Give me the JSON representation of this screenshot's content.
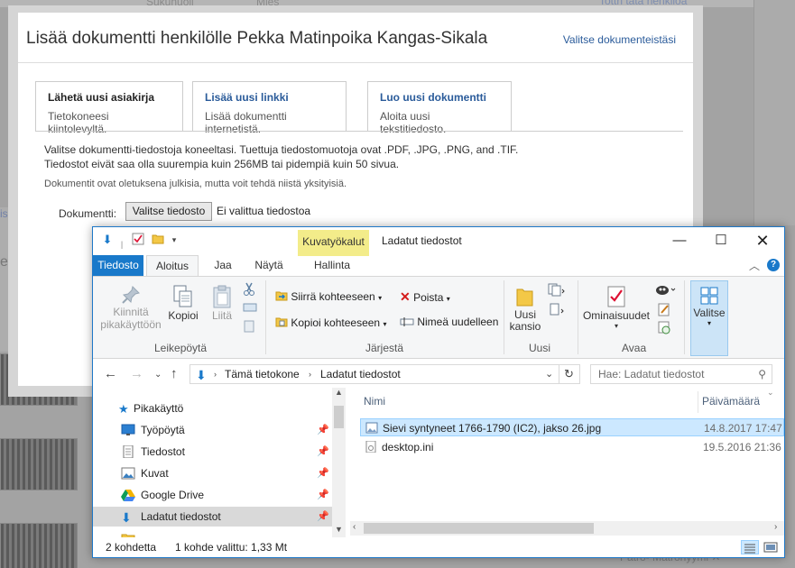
{
  "background": {
    "top_labels": [
      "Sukunuoli",
      "Mies",
      "Tottri tata henkilöä"
    ],
    "left_link": "is",
    "left_letter": "e",
    "bottom_text": "Patro- Matronyymi ✕"
  },
  "dialog": {
    "title": "Lisää dokumentti henkilölle Pekka Matinpoika Kangas-Sikala",
    "choose_link": "Valitse dokumenteistäsi",
    "tabs": [
      {
        "title": "Lähetä uusi asiakirja",
        "subtitle": "Tietokoneesi kiintolevyltä."
      },
      {
        "title": "Lisää uusi linkki",
        "subtitle": "Lisää dokumentti internetistä."
      },
      {
        "title": "Luo uusi dokumentti",
        "subtitle": "Aloita uusi tekstitiedosto."
      }
    ],
    "info_line1": "Valitse dokumentti-tiedostoja koneeltasi. Tuettuja tiedostomuotoja ovat .PDF, .JPG, .PNG, and .TIF.",
    "info_line2": "Tiedostot eivät saa olla suurempia kuin 256MB tai pidempiä kuin 50 sivua.",
    "note": "Dokumentit ovat oletuksena julkisia, mutta voit tehdä niistä yksityisiä.",
    "document_label": "Dokumentti:",
    "file_button": "Valitse tiedosto",
    "file_status": "Ei valittua tiedostoa"
  },
  "explorer": {
    "context_tab": "Kuvatyökalut",
    "title": "Ladatut tiedostot",
    "ribbon_tabs": [
      "Tiedosto",
      "Aloitus",
      "Jaa",
      "Näytä",
      "Hallinta"
    ],
    "ribbon": {
      "pin_label": "Kiinnitä pikakäyttöön",
      "copy_label": "Kopioi",
      "paste_label": "Liitä",
      "group_clipboard": "Leikepöytä",
      "move_to": "Siirrä kohteeseen",
      "copy_to": "Kopioi kohteeseen",
      "delete": "Poista",
      "rename": "Nimeä uudelleen",
      "group_organize": "Järjestä",
      "new_folder": "Uusi kansio",
      "group_new": "Uusi",
      "properties": "Ominaisuudet",
      "group_open": "Avaa",
      "select": "Valitse"
    },
    "address": {
      "crumbs": [
        "Tämä tietokone",
        "Ladatut tiedostot"
      ],
      "search_placeholder": "Hae: Ladatut tiedostot"
    },
    "nav_items": [
      {
        "label": "Pikakäyttö",
        "pinned": false
      },
      {
        "label": "Työpöytä",
        "pinned": true
      },
      {
        "label": "Tiedostot",
        "pinned": true
      },
      {
        "label": "Kuvat",
        "pinned": true
      },
      {
        "label": "Google Drive",
        "pinned": true
      },
      {
        "label": "Ladatut tiedostot",
        "pinned": true
      }
    ],
    "columns": {
      "name": "Nimi",
      "date": "Päivämäärä"
    },
    "files": [
      {
        "name": "Sievi syntyneet 1766-1790 (IC2), jakso 26.jpg",
        "date": "14.8.2017 17:47",
        "selected": true
      },
      {
        "name": "desktop.ini",
        "date": "19.5.2016 21:36",
        "selected": false
      }
    ],
    "status": {
      "count": "2 kohdetta",
      "selection": "1 kohde valittu: 1,33 Mt"
    }
  }
}
